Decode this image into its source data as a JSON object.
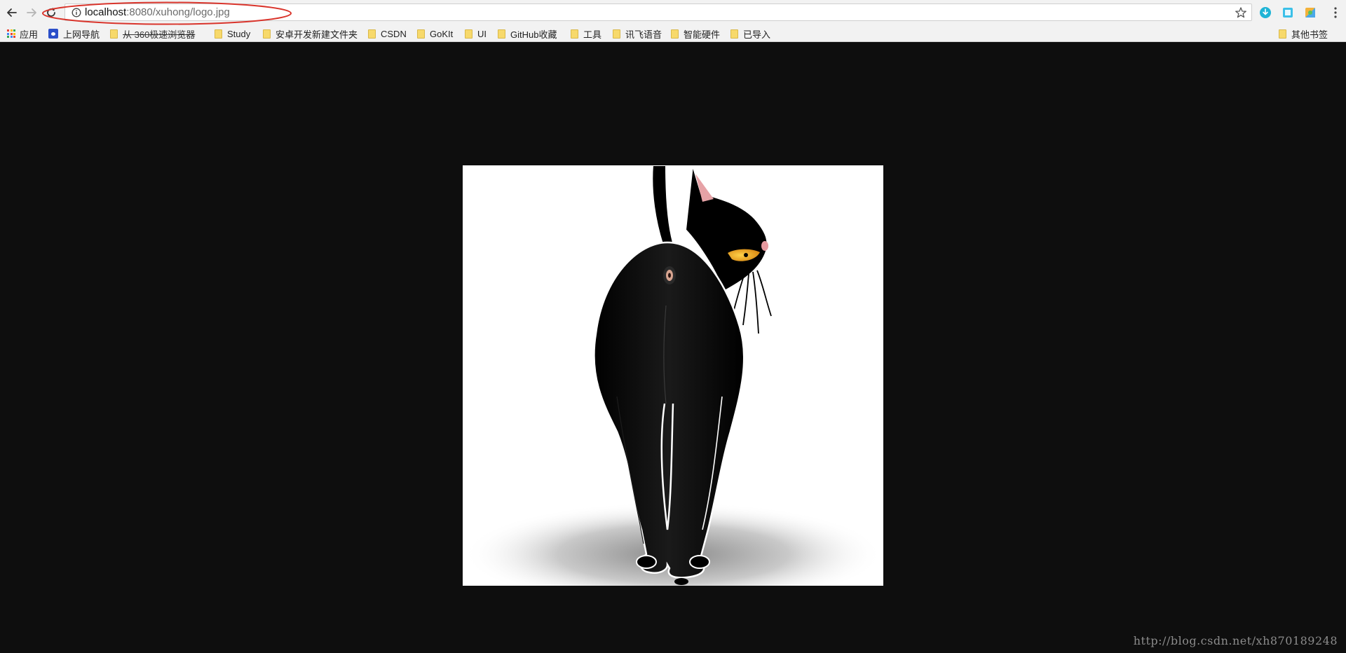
{
  "address_bar": {
    "host": "localhost",
    "path": ":8080/xuhong/logo.jpg"
  },
  "bookmarks": {
    "apps": "应用",
    "items": [
      "上网导航",
      "从 360极速浏览器",
      "Study",
      "安卓开发新建文件夹",
      "CSDN",
      "GoKIt",
      "UI",
      "GitHub收藏",
      "工具",
      "讯飞语音",
      "智能硬件",
      "已导入"
    ],
    "other": "其他书签"
  },
  "watermark": "http://blog.csdn.net/xh870189248",
  "colors": {
    "page_background": "#0e0e0e",
    "annotation": "#d9342b",
    "toolbar": "#f2f2f2"
  },
  "icons": [
    "back-icon",
    "forward-icon",
    "reload-icon",
    "info-icon",
    "star-icon",
    "menu-icon"
  ]
}
